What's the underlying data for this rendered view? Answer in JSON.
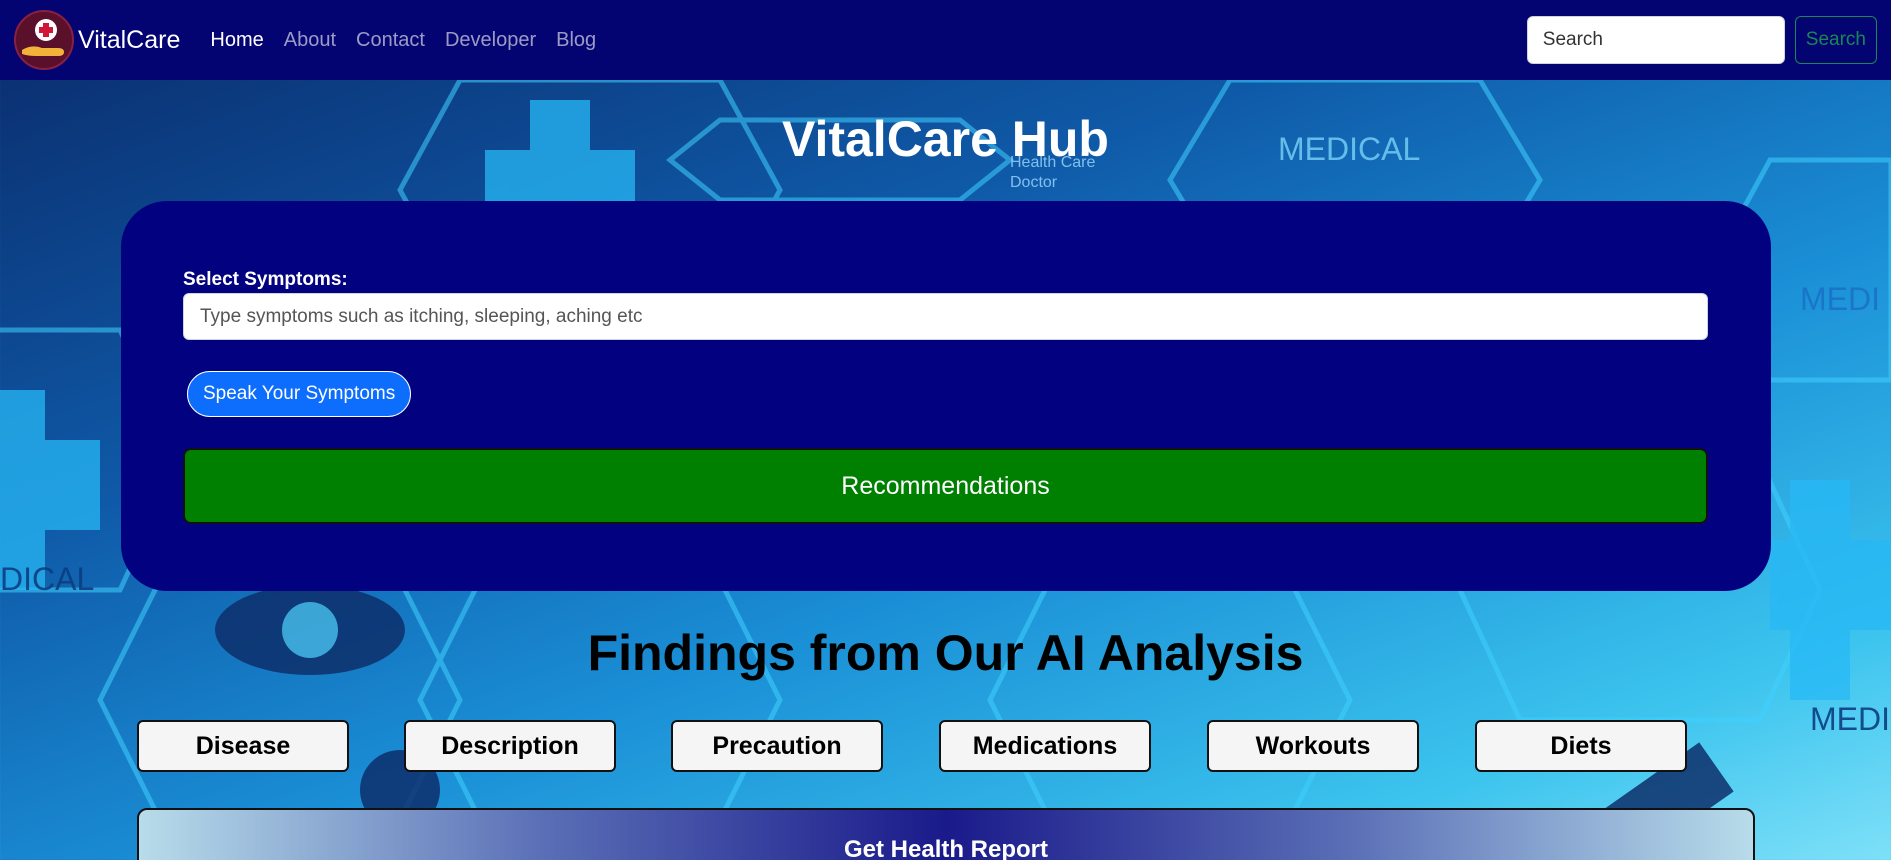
{
  "navbar": {
    "brand": "VitalCare",
    "links": [
      {
        "label": "Home"
      },
      {
        "label": "About"
      },
      {
        "label": "Contact"
      },
      {
        "label": "Developer"
      },
      {
        "label": "Blog"
      }
    ],
    "search_placeholder": "Search",
    "search_button": "Search"
  },
  "hero": {
    "title": "VitalCare Hub"
  },
  "symptom_form": {
    "label": "Select Symptoms:",
    "input_placeholder": "Type symptoms such as itching, sleeping, aching etc",
    "speak_button": "Speak Your Symptoms",
    "recommend_button": "Recommendations"
  },
  "findings": {
    "title": "Findings from Our AI Analysis",
    "tabs": [
      {
        "label": "Disease"
      },
      {
        "label": "Description"
      },
      {
        "label": "Precaution"
      },
      {
        "label": "Medications"
      },
      {
        "label": "Workouts"
      },
      {
        "label": "Diets"
      }
    ]
  },
  "report": {
    "label": "Get Health Report"
  },
  "background_labels": {
    "medical_1": "MEDICAL",
    "medical_2": "MEDI",
    "medical_3": "DICAL",
    "medical_4": "MEDI",
    "health_care": "Health Care",
    "doctor": "Doctor"
  },
  "colors": {
    "navbar_bg": "#030371",
    "card_bg": "#020280",
    "recommend_bg": "#008000",
    "speak_bg": "#0d6efd",
    "search_btn": "#198754"
  }
}
